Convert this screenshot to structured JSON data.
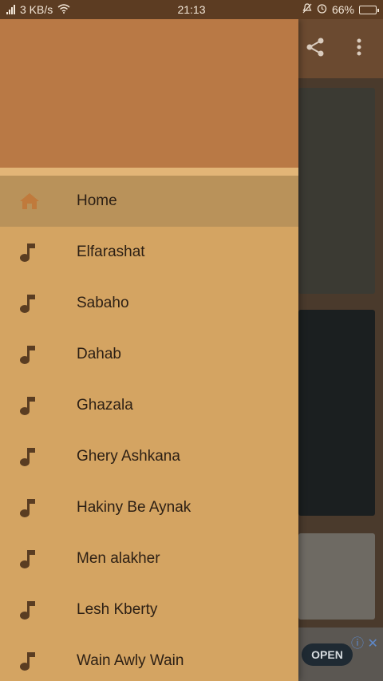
{
  "status_bar": {
    "speed": "3 KB/s",
    "time": "21:13",
    "battery": "66%"
  },
  "drawer": {
    "items": [
      {
        "label": "Home",
        "icon": "home-icon",
        "active": true
      },
      {
        "label": "Elfarashat",
        "icon": "music-note-icon"
      },
      {
        "label": "Sabaho",
        "icon": "music-note-icon"
      },
      {
        "label": "Dahab",
        "icon": "music-note-icon"
      },
      {
        "label": "Ghazala",
        "icon": "music-note-icon"
      },
      {
        "label": "Ghery Ashkana",
        "icon": "music-note-icon"
      },
      {
        "label": "Hakiny Be Aynak",
        "icon": "music-note-icon"
      },
      {
        "label": "Men alakher",
        "icon": "music-note-icon"
      },
      {
        "label": "Lesh Kberty",
        "icon": "music-note-icon"
      },
      {
        "label": "Wain Awly Wain",
        "icon": "music-note-icon"
      }
    ]
  },
  "ad": {
    "open_label": "OPEN"
  },
  "colors": {
    "header": "#b97945",
    "drawer_bg": "#d4a462",
    "active_item": "#b9925a",
    "icon_home": "#c07a3c",
    "icon_note": "#5a3d22"
  }
}
